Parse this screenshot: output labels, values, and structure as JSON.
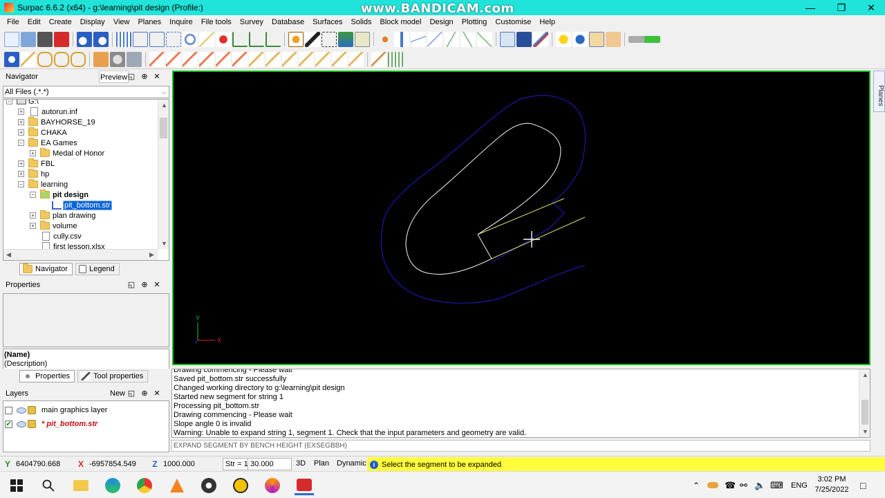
{
  "window": {
    "title": "Surpac 6.6.2 (x64) - g:\\learning\\pit design (Profile:)",
    "watermark": "www.BANDICAM.com"
  },
  "menu": [
    "File",
    "Edit",
    "Create",
    "Display",
    "View",
    "Planes",
    "Inquire",
    "File tools",
    "Survey",
    "Database",
    "Surfaces",
    "Solids",
    "Block model",
    "Design",
    "Plotting",
    "Customise",
    "Help"
  ],
  "navigator": {
    "title": "Navigator",
    "preview_label": "Preview",
    "filter": "All Files (.*.*)",
    "root": "G:\\",
    "items": [
      {
        "label": "autorun.inf",
        "type": "file",
        "depth": 1,
        "expander": "+"
      },
      {
        "label": "BAYHORSE_19",
        "type": "folder",
        "depth": 1,
        "expander": "+"
      },
      {
        "label": "CHAKA",
        "type": "folder",
        "depth": 1,
        "expander": "+"
      },
      {
        "label": "EA Games",
        "type": "folder",
        "depth": 1,
        "expander": "−"
      },
      {
        "label": "Medal of Honor",
        "type": "folder",
        "depth": 2,
        "expander": "+"
      },
      {
        "label": "FBL",
        "type": "folder",
        "depth": 1,
        "expander": "+"
      },
      {
        "label": "hp",
        "type": "folder",
        "depth": 1,
        "expander": "+"
      },
      {
        "label": "learning",
        "type": "folder",
        "depth": 1,
        "expander": "−"
      },
      {
        "label": "pit design",
        "type": "folder-active",
        "depth": 2,
        "expander": "−"
      },
      {
        "label": "pit_bottom.str",
        "type": "string-file",
        "depth": 3,
        "expander": ""
      },
      {
        "label": "plan drawing",
        "type": "folder",
        "depth": 2,
        "expander": "+"
      },
      {
        "label": "volume",
        "type": "folder",
        "depth": 2,
        "expander": "+"
      },
      {
        "label": "cully.csv",
        "type": "file",
        "depth": 2,
        "expander": ""
      },
      {
        "label": "first lesson.xlsx",
        "type": "file",
        "depth": 2,
        "expander": ""
      }
    ],
    "tabs": {
      "navigator": "Navigator",
      "legend": "Legend"
    }
  },
  "properties": {
    "title": "Properties",
    "name": "(Name)",
    "description": "(Description)",
    "tabs": {
      "properties": "Properties",
      "tool_properties": "Tool properties"
    }
  },
  "layers": {
    "title": "Layers",
    "new_label": "New",
    "items": [
      {
        "label": "main graphics layer",
        "checked": false,
        "active": false
      },
      {
        "label": "* pit_bottom.str",
        "checked": true,
        "active": true
      }
    ]
  },
  "viewport": {
    "axis_y": "Y",
    "axis_x": "X",
    "colors": {
      "outer": "#1a1aa8",
      "inner": "#e6e6e6",
      "segment": "#d9d96a",
      "background": "#000000"
    }
  },
  "side_tab": "Planes",
  "messages": [
    "Drawing commencing - Please wait",
    "Saved pit_bottom.str successfully",
    "Changed working directory to g:\\learning\\pit design",
    "Started new segment for string 1",
    "Processing pit_bottom.str",
    "Drawing commencing - Please wait",
    "Slope angle 0 is invalid",
    "Warning: Unable to expand string 1, segment 1. Check that the input parameters and geometry are valid."
  ],
  "command_line": "EXPAND SEGMENT BY BENCH HEIGHT (EXSEGBBH)",
  "status": {
    "y": "6404790.668",
    "x": "-6957854.549",
    "z": "1000.000",
    "str": "Str = 1",
    "angle": "30.000 angle",
    "mode_3d": "3D",
    "mode_plan": "Plan",
    "mode_dynamic": "Dynamic",
    "message": "Select the segment to be expanded"
  },
  "taskbar": {
    "language": "ENG",
    "time": "3:02 PM",
    "date": "7/25/2022"
  }
}
